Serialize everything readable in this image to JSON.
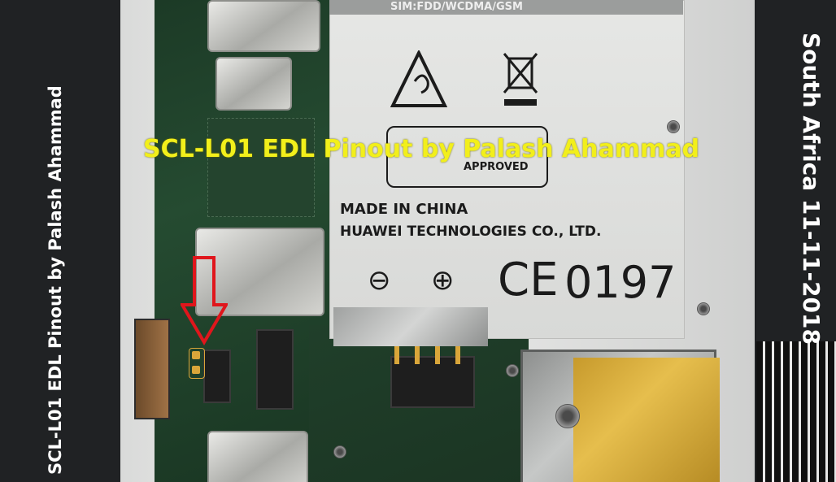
{
  "photo": {
    "sticker": {
      "sim_line": "SIM:FDD/WCDMA/GSM",
      "approved": "APPROVED",
      "made_in": "MADE IN CHINA",
      "manufacturer": "HUAWEI TECHNOLOGIES CO., LTD.",
      "minus": "⊖",
      "plus": "⊕",
      "ce_mark": "CE",
      "ce_number": "0197"
    }
  },
  "overlay": {
    "title": "SCL-L01 EDL Pinout by Palash Ahammad",
    "left_vertical": "SCL-L01 EDL Pinout by Palash Ahammad",
    "right_vertical": "South Africa 11-11-2018"
  },
  "colors": {
    "title_text": "#f2ef1b",
    "side_text": "#ffffff",
    "arrow_outline": "#e0161c",
    "test_point": "#d9a63a"
  }
}
